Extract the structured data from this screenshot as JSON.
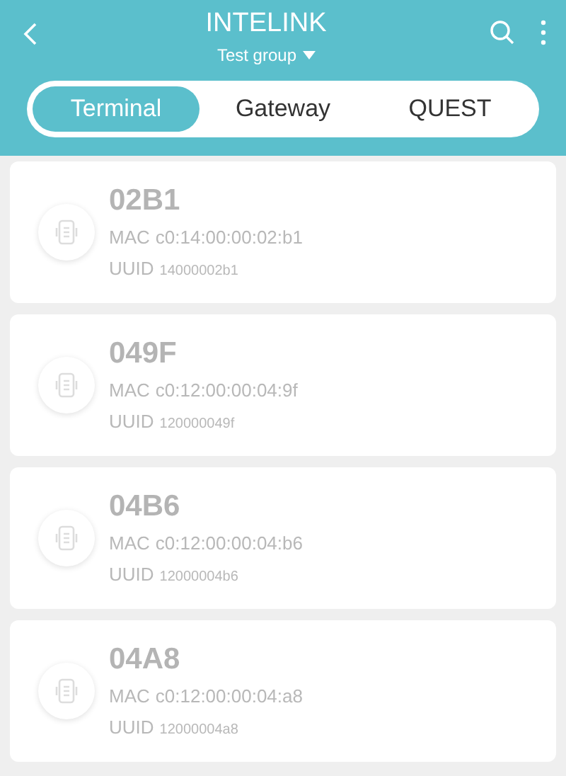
{
  "header": {
    "title": "INTELINK",
    "subtitle": "Test group"
  },
  "tabs": [
    {
      "label": "Terminal",
      "selected": true
    },
    {
      "label": "Gateway",
      "selected": false
    },
    {
      "label": "QUEST",
      "selected": false
    }
  ],
  "devices": [
    {
      "name": "02B1",
      "mac_label": "MAC",
      "mac": "c0:14:00:00:02:b1",
      "uuid_label": "UUID",
      "uuid": "14000002b1",
      "offline": true
    },
    {
      "name": "049F",
      "mac_label": "MAC",
      "mac": "c0:12:00:00:04:9f",
      "uuid_label": "UUID",
      "uuid": "120000049f",
      "offline": true
    },
    {
      "name": "04B6",
      "mac_label": "MAC",
      "mac": "c0:12:00:00:04:b6",
      "uuid_label": "UUID",
      "uuid": "12000004b6",
      "offline": true
    },
    {
      "name": "04A8",
      "mac_label": "MAC",
      "mac": "c0:12:00:00:04:a8",
      "uuid_label": "UUID",
      "uuid": "12000004a8",
      "offline": true
    }
  ]
}
